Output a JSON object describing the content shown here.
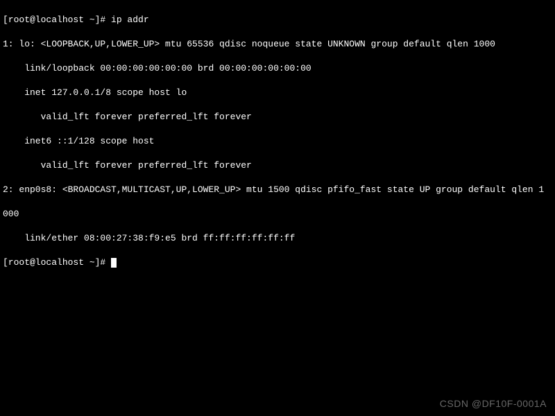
{
  "terminal": {
    "prompt1": "[root@localhost ~]# ",
    "command": "ip addr",
    "output": {
      "l0": "1: lo: <LOOPBACK,UP,LOWER_UP> mtu 65536 qdisc noqueue state UNKNOWN group default qlen 1000",
      "l1": "    link/loopback 00:00:00:00:00:00 brd 00:00:00:00:00:00",
      "l2": "    inet 127.0.0.1/8 scope host lo",
      "l3": "       valid_lft forever preferred_lft forever",
      "l4": "    inet6 ::1/128 scope host",
      "l5": "       valid_lft forever preferred_lft forever",
      "l6": "2: enp0s8: <BROADCAST,MULTICAST,UP,LOWER_UP> mtu 1500 qdisc pfifo_fast state UP group default qlen 1",
      "l7": "000",
      "l8": "    link/ether 08:00:27:38:f9:e5 brd ff:ff:ff:ff:ff:ff"
    },
    "prompt2": "[root@localhost ~]# "
  },
  "watermark": "CSDN @DF10F-0001A"
}
